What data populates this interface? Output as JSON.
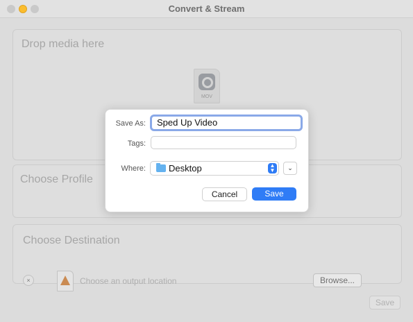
{
  "window": {
    "title": "Convert & Stream"
  },
  "drop_section": {
    "title": "Drop media here",
    "file_type_label": "MOV"
  },
  "profile_section": {
    "title": "Choose Profile"
  },
  "destination_section": {
    "title": "Choose Destination",
    "clear_label": "×",
    "placeholder": "Choose an output location",
    "browse_label": "Browse..."
  },
  "footer": {
    "save_label": "Save"
  },
  "save_dialog": {
    "save_as_label": "Save As:",
    "save_as_value": "Sped Up Video",
    "tags_label": "Tags:",
    "tags_value": "",
    "where_label": "Where:",
    "where_value": "Desktop",
    "cancel_label": "Cancel",
    "save_label": "Save"
  },
  "colors": {
    "accent": "#2f7cf6",
    "folder": "#64b2ef",
    "focus_ring": "#8aa9e8"
  },
  "icons": [
    "quicktime-mov-file-icon",
    "vlc-cone-icon",
    "folder-icon",
    "chevron-down-icon",
    "up-down-stepper-icon",
    "clear-x-icon"
  ]
}
